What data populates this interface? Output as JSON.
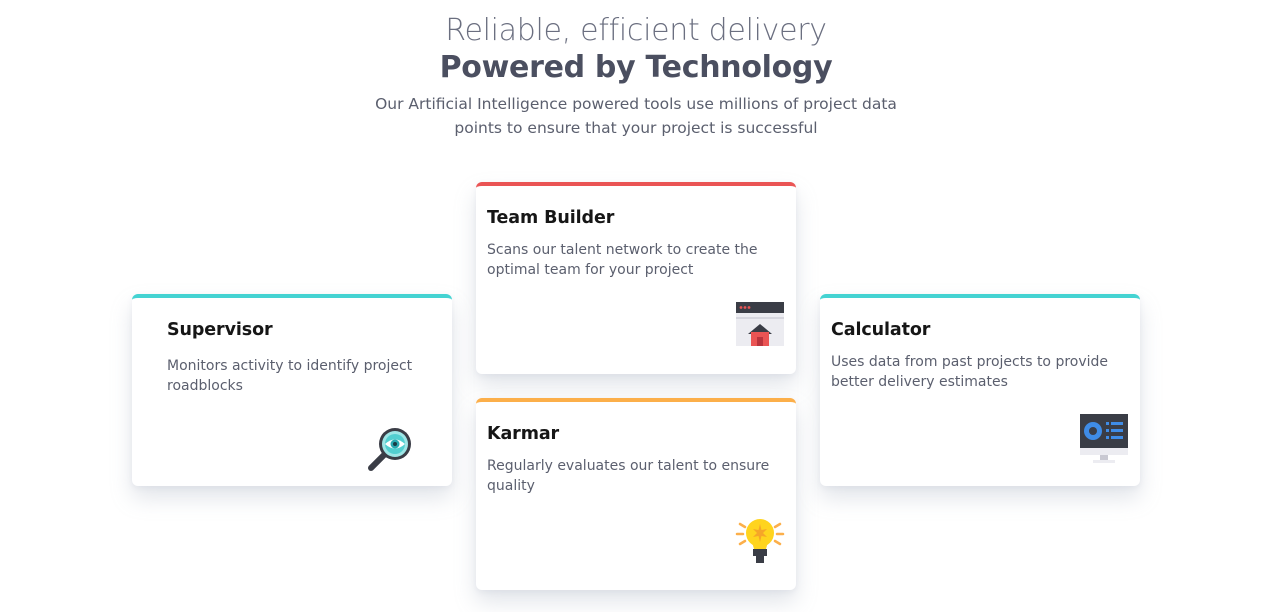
{
  "header": {
    "subtitle": "Reliable, efficient delivery",
    "title": "Powered by Technology",
    "description": "Our Artificial Intelligence powered tools use millions of project data points to ensure that your project is successful"
  },
  "colors": {
    "supervisor_accent": "#44d3d2",
    "team_builder_accent": "#ea5454",
    "karmar_accent": "#fcaf4a",
    "calculator_accent": "#44d3d2"
  },
  "cards": {
    "supervisor": {
      "title": "Supervisor",
      "text": "Monitors activity to identify project roadblocks",
      "icon": "magnifier-eye-icon"
    },
    "team_builder": {
      "title": "Team Builder",
      "text": "Scans our talent network to create the optimal team for your project",
      "icon": "browser-house-icon"
    },
    "karmar": {
      "title": "Karmar",
      "text": "Regularly evaluates our talent to ensure quality",
      "icon": "lightbulb-icon"
    },
    "calculator": {
      "title": "Calculator",
      "text": "Uses data from past projects to provide better delivery estimates",
      "icon": "monitor-dashboard-icon"
    }
  }
}
